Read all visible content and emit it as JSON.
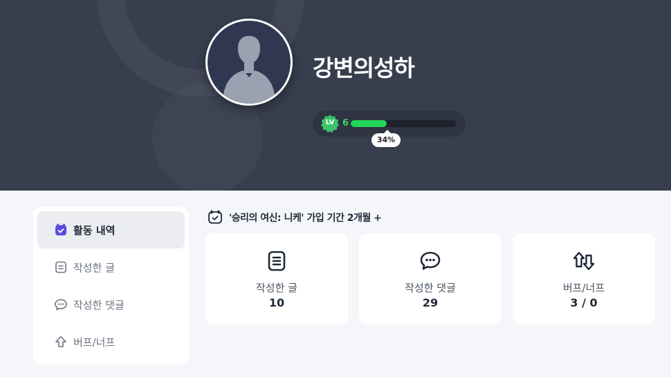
{
  "profile": {
    "nickname": "강변의성하",
    "level_badge": "LV",
    "level": "6",
    "level_progress_percent": 34,
    "level_progress_label": "34%"
  },
  "sidebar": {
    "items": [
      {
        "label": "활동 내역",
        "icon": "calendar-check-icon",
        "active": true
      },
      {
        "label": "작성한 글",
        "icon": "document-icon",
        "active": false
      },
      {
        "label": "작성한 댓글",
        "icon": "comment-icon",
        "active": false
      },
      {
        "label": "버프/너프",
        "icon": "arrow-up-icon",
        "active": false
      }
    ]
  },
  "membership": {
    "text": "'승리의 여신: 니케' 가입 기간 2개월 +"
  },
  "stats": [
    {
      "label": "작성한 글",
      "value": "10",
      "icon": "document-icon"
    },
    {
      "label": "작성한 댓글",
      "value": "29",
      "icon": "comment-icon"
    },
    {
      "label": "버프/너프",
      "value": "3 / 0",
      "icon": "up-down-arrows-icon"
    }
  ],
  "colors": {
    "hero_bg": "#373e4d",
    "accent_purple": "#5b4ee0",
    "level_green": "#22d35a"
  }
}
